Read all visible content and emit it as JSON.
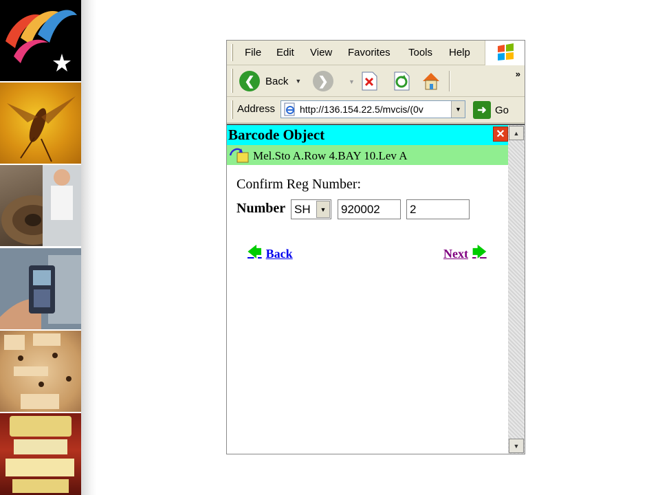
{
  "menubar": {
    "items": [
      "File",
      "Edit",
      "View",
      "Favorites",
      "Tools",
      "Help"
    ]
  },
  "toolbar": {
    "back_label": "Back",
    "overflow": "»"
  },
  "address_bar": {
    "label": "Address",
    "url": "http://136.154.22.5/mvcis/(0v",
    "go_label": "Go"
  },
  "page": {
    "title": "Barcode Object",
    "location": "Mel.Sto A.Row 4.BAY 10.Lev A",
    "prompt": "Confirm Reg Number:",
    "number_label": "Number",
    "prefix_select": "SH",
    "reg_number": "920002",
    "part_number": "2",
    "back_link": "Back",
    "next_link": "Next"
  },
  "colors": {
    "title_bar": "#00ffff",
    "location_bar": "#90ee90",
    "visited_link": "#800080",
    "link": "#0000ee",
    "arrow": "#00cc00"
  }
}
